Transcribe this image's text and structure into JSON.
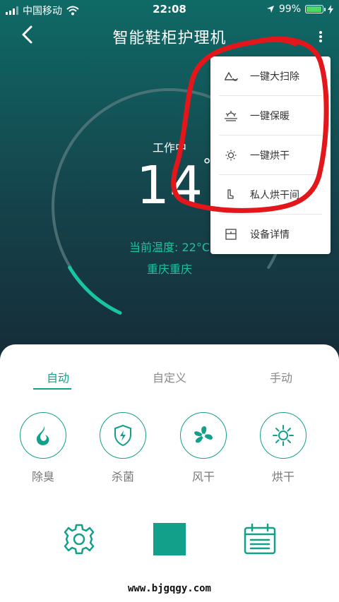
{
  "status_bar": {
    "carrier": "中国移动",
    "time": "22:08",
    "battery": "99%",
    "wifi_icon": "wifi-icon",
    "location_icon": "location-arrow-icon",
    "charging_icon": "bolt-icon"
  },
  "header": {
    "title": "智能鞋柜护理机",
    "back_icon": "chevron-left-icon",
    "more_icon": "more-vertical-icon"
  },
  "gauge": {
    "state": "工作中",
    "temperature_value": "14",
    "temperature_unit": "℃",
    "current_temp_label": "当前温度: 22°C",
    "city": "重庆重庆",
    "progress_fraction": 0.14
  },
  "dropdown_menu": {
    "items": [
      {
        "label": "一键大扫除",
        "icon": "clean-icon"
      },
      {
        "label": "一键保暖",
        "icon": "warm-icon"
      },
      {
        "label": "一键烘干",
        "icon": "sun-icon"
      },
      {
        "label": "私人烘干间",
        "icon": "boot-icon"
      },
      {
        "label": "设备详情",
        "icon": "device-icon"
      }
    ]
  },
  "tabs": {
    "items": [
      "自动",
      "自定义",
      "手动"
    ],
    "active": "自动"
  },
  "functions": [
    {
      "label": "除臭",
      "icon": "flame-icon"
    },
    {
      "label": "杀菌",
      "icon": "shield-bolt-icon"
    },
    {
      "label": "风干",
      "icon": "fan-icon"
    },
    {
      "label": "烘干",
      "icon": "sun-icon"
    }
  ],
  "bottom_actions": {
    "settings_icon": "gear-icon",
    "stop_icon": "stop-icon",
    "schedule_icon": "calendar-icon"
  },
  "watermark": "www.bjgqgy.com",
  "colors": {
    "accent": "#13a08a",
    "header_gradient_top": "#0f6a66",
    "header_gradient_bottom": "#152b37",
    "annotation_red": "#e3161b"
  }
}
